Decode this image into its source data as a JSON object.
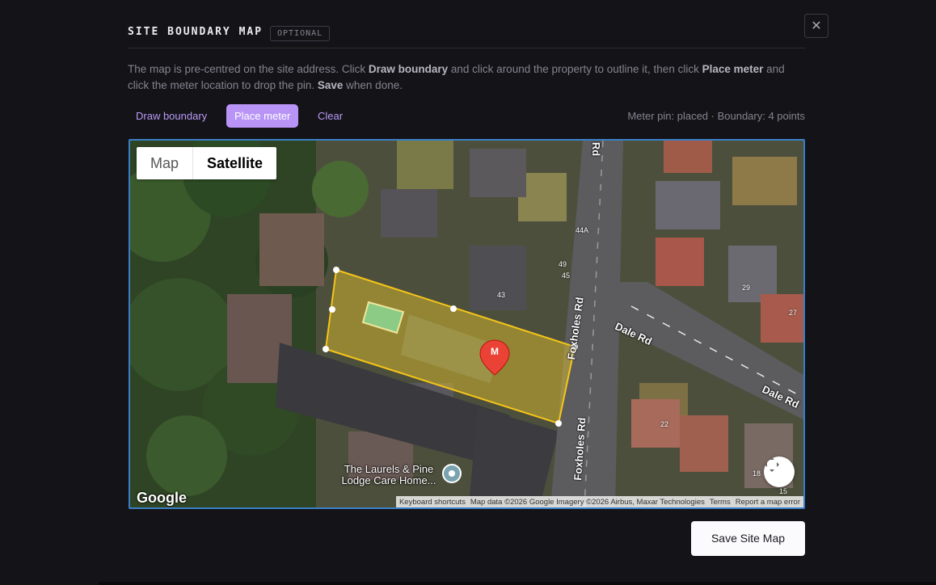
{
  "header": {
    "title": "SITE BOUNDARY MAP",
    "badge": "OPTIONAL",
    "close_symbol": "✕"
  },
  "description": {
    "part1": "The map is pre-centred on the site address. Click ",
    "bold1": "Draw boundary",
    "part2": " and click around the property to outline it, then click ",
    "bold2": "Place meter",
    "part3": " and click the meter location to drop the pin. ",
    "bold3": "Save",
    "part4": " when done."
  },
  "toolbar": {
    "draw_label": "Draw boundary",
    "place_label": "Place meter",
    "clear_label": "Clear",
    "active_tool": "Place meter"
  },
  "status": "Meter pin: placed · Boundary: 4 points",
  "map": {
    "type_options": [
      "Map",
      "Satellite"
    ],
    "selected_type": "Satellite",
    "google_logo": "Google",
    "marker_letter": "M",
    "poi_label": "The Laurels & Pine Lodge Care Home...",
    "road_labels": {
      "rd_top": "Rd",
      "foxholes_1": "Foxholes Rd",
      "foxholes_2": "Foxholes Rd",
      "dale_1": "Dale Rd",
      "dale_2": "Dale Rd"
    },
    "house_numbers": {
      "n44a": "44A",
      "n49": "49",
      "n45": "45",
      "n43": "43",
      "n29": "29",
      "n27": "27",
      "n22": "22",
      "n18": "18",
      "n15": "15"
    },
    "attribution": {
      "shortcuts": "Keyboard shortcuts",
      "data": "Map data ©2026 Google Imagery ©2026 Airbus, Maxar Technologies",
      "terms": "Terms",
      "report": "Report a map error"
    },
    "colors": {
      "boundary": "#f5c518",
      "marker": "#ea4335",
      "map_border": "#3a7fc6"
    }
  },
  "footer": {
    "save_label": "Save Site Map"
  },
  "colors": {
    "background": "#141318",
    "accent": "#b894f7"
  }
}
